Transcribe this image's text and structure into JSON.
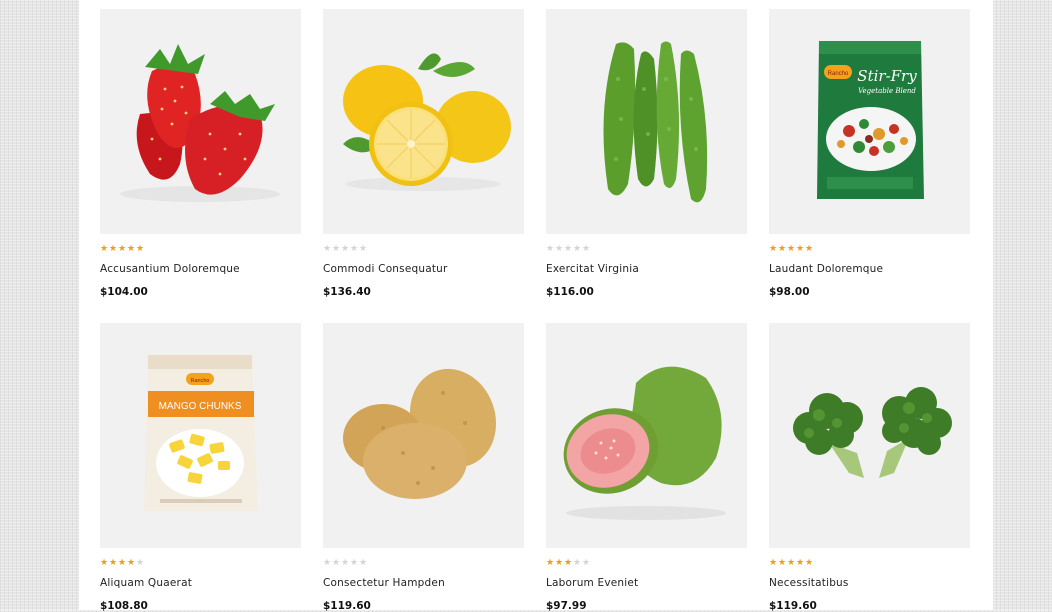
{
  "products": [
    {
      "name": "Accusantium Doloremque",
      "price": "$104.00",
      "rating": 5,
      "image": "strawberry-image"
    },
    {
      "name": "Commodi Consequatur",
      "price": "$136.40",
      "rating": 0,
      "image": "lemon-image"
    },
    {
      "name": "Exercitat Virginia",
      "price": "$116.00",
      "rating": 0,
      "image": "bitter-gourd-image"
    },
    {
      "name": "Laudant Doloremque",
      "price": "$98.00",
      "rating": 5,
      "image": "stir-fry-bag-image",
      "pack_brand": "Rancho",
      "pack_title": "Stir-Fry",
      "pack_subtitle": "Vegetable Blend"
    },
    {
      "name": "Aliquam Quaerat",
      "price": "$108.80",
      "rating": 4,
      "image": "mango-chunks-bag-image",
      "pack_brand": "Rancho",
      "pack_title": "MANGO CHUNKS"
    },
    {
      "name": "Consectetur Hampden",
      "price": "$119.60",
      "rating": 0,
      "image": "potato-image"
    },
    {
      "name": "Laborum Eveniet",
      "price": "$97.99",
      "rating": 3,
      "image": "guava-image"
    },
    {
      "name": "Necessitatibus",
      "price": "$119.60",
      "rating": 5,
      "image": "broccoli-image"
    }
  ],
  "colors": {
    "star_on": "#f39c12",
    "star_off": "#d4d4d4",
    "thumb_bg": "#f1f1f1"
  }
}
